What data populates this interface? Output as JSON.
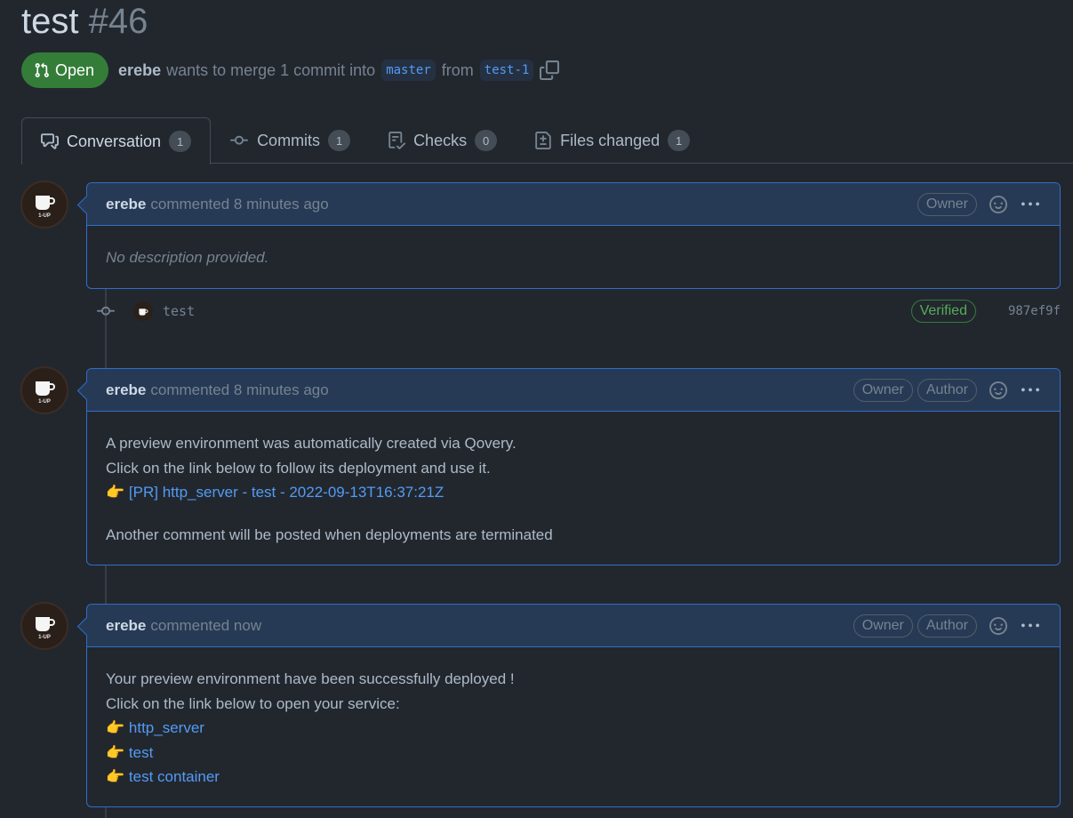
{
  "pr": {
    "title": "test",
    "number": "#46",
    "state_label": "Open",
    "author": "erebe",
    "merge_text": "wants to merge 1 commit into",
    "base_branch": "master",
    "from_text": "from",
    "head_branch": "test-1"
  },
  "tabs": [
    {
      "label": "Conversation",
      "count": "1",
      "icon": "comment-discussion-icon"
    },
    {
      "label": "Commits",
      "count": "1",
      "icon": "git-commit-icon"
    },
    {
      "label": "Checks",
      "count": "0",
      "icon": "checklist-icon"
    },
    {
      "label": "Files changed",
      "count": "1",
      "icon": "file-diff-icon"
    }
  ],
  "avatar_label": "1-UP",
  "comments": [
    {
      "author": "erebe",
      "meta": "commented 8 minutes ago",
      "roles": [
        "Owner"
      ],
      "body_italic": "No description provided."
    },
    {
      "author": "erebe",
      "meta": "commented 8 minutes ago",
      "roles": [
        "Owner",
        "Author"
      ],
      "line1": "A preview environment was automatically created via Qovery.",
      "line2": "Click on the link below to follow its deployment and use it.",
      "emoji": "👉",
      "link": "[PR] http_server - test - 2022-09-13T16:37:21Z",
      "line4": "Another comment will be posted when deployments are terminated"
    },
    {
      "author": "erebe",
      "meta": "commented now",
      "roles": [
        "Owner",
        "Author"
      ],
      "line1": "Your preview environment have been successfully deployed !",
      "line2": "Click on the link below to open your service:",
      "emoji": "👉",
      "links": [
        "http_server",
        "test",
        "test container"
      ]
    }
  ],
  "commit": {
    "message": "test",
    "verified_label": "Verified",
    "sha": "987ef9f"
  },
  "colors": {
    "background": "#22272e",
    "open_green": "#347d39",
    "link_blue": "#539bf5",
    "comment_border": "#316dca",
    "comment_header": "#263a55"
  }
}
